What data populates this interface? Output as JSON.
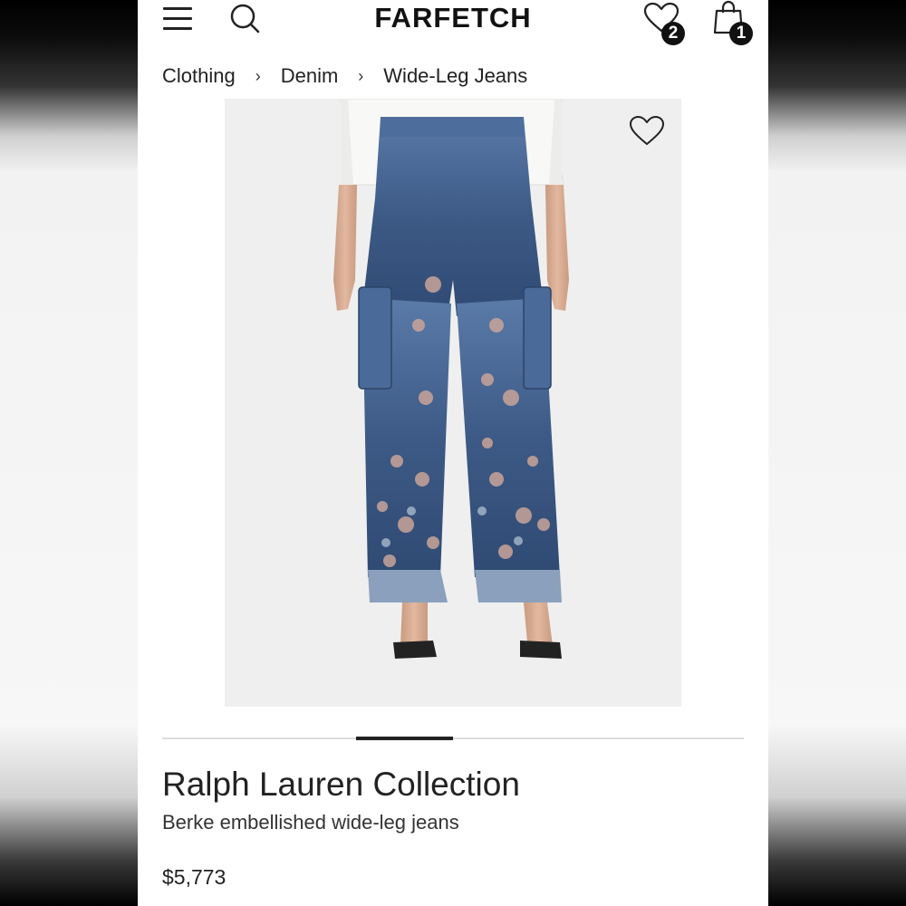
{
  "header": {
    "logo": "FARFETCH",
    "icons": [
      "menu-icon",
      "search-icon",
      "heart-icon",
      "shopping-bag-icon"
    ],
    "wishlist_count": "2",
    "bag_count": "1"
  },
  "breadcrumb": {
    "items": [
      "Clothing",
      "Denim",
      "Wide-Leg Jeans"
    ],
    "separator": "›"
  },
  "product": {
    "brand": "Ralph Lauren Collection",
    "name": "Berke embellished wide-leg jeans",
    "price": "$5,773"
  },
  "carousel": {
    "active_index": 2,
    "total": 6
  },
  "colors": {
    "denim": "#3d5a86",
    "accent": "#111111"
  }
}
